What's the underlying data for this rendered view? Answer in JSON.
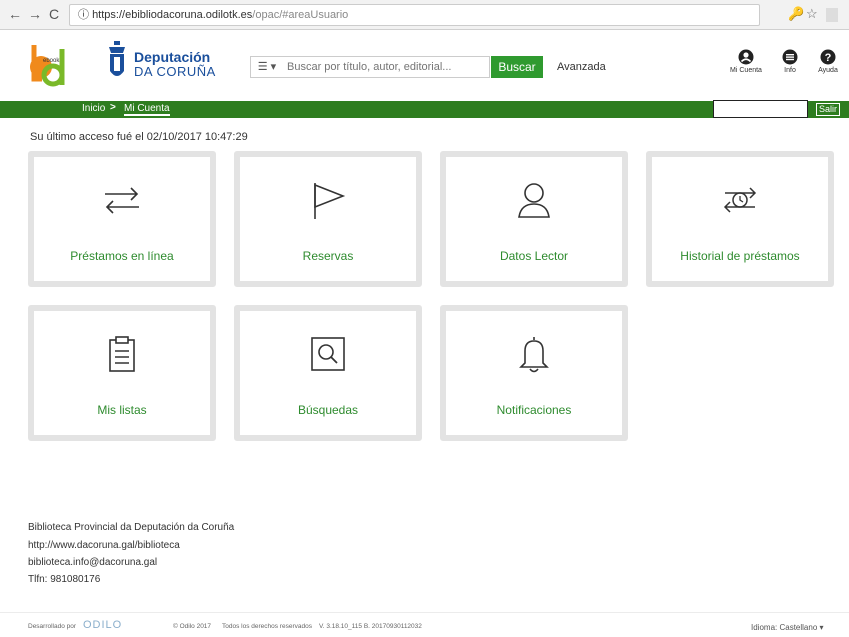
{
  "browser": {
    "url_host": "https://ebibliodacoruna.odilotk.es",
    "url_path": "/opac/#areaUsuario"
  },
  "header": {
    "logo_text": "ebook",
    "dep_title1": "Deputación",
    "dep_title2": "DA CORUÑA",
    "search_placeholder": "Buscar por título, autor, editorial...",
    "search_button": "Buscar",
    "advanced": "Avanzada",
    "icons": [
      {
        "name": "user-icon",
        "label": "Mi Cuenta"
      },
      {
        "name": "info-icon",
        "label": "Info"
      },
      {
        "name": "help-icon",
        "label": "Ayuda"
      }
    ]
  },
  "breadcrumb": {
    "home": "Inicio",
    "separator": ">",
    "current": "Mi Cuenta",
    "logout": "Salir"
  },
  "main": {
    "last_access": "Su último acceso fué el 02/10/2017 10:47:29",
    "cards": [
      {
        "label": "Préstamos en línea",
        "icon": "transfer-arrows-icon"
      },
      {
        "label": "Reservas",
        "icon": "flag-icon"
      },
      {
        "label": "Datos Lector",
        "icon": "user-icon"
      },
      {
        "label": "Historial de préstamos",
        "icon": "history-arrows-icon"
      },
      {
        "label": "Mis listas",
        "icon": "clipboard-icon"
      },
      {
        "label": "Búsquedas",
        "icon": "search-icon"
      },
      {
        "label": "Notificaciones",
        "icon": "bell-icon"
      }
    ]
  },
  "footer": {
    "lines": [
      "Biblioteca Provincial da Deputación da Coruña",
      "http://www.dacoruna.gal/biblioteca",
      "biblioteca.info@dacoruna.gal",
      "Tlfn: 981080176"
    ],
    "developed_by": "Desarrollado por",
    "brand": "ODILO",
    "copyright": "© Odilo 2017",
    "rights": "Todos los derechos reservados",
    "version": "V. 3.18.10_115 B. 20170930112032",
    "language_label": "Idioma:",
    "language": "Castellano"
  },
  "colors": {
    "green": "#2e7d1f",
    "button_green": "#2f9a2f",
    "label_green": "#2e8b2e",
    "blue": "#1a4f9c"
  }
}
